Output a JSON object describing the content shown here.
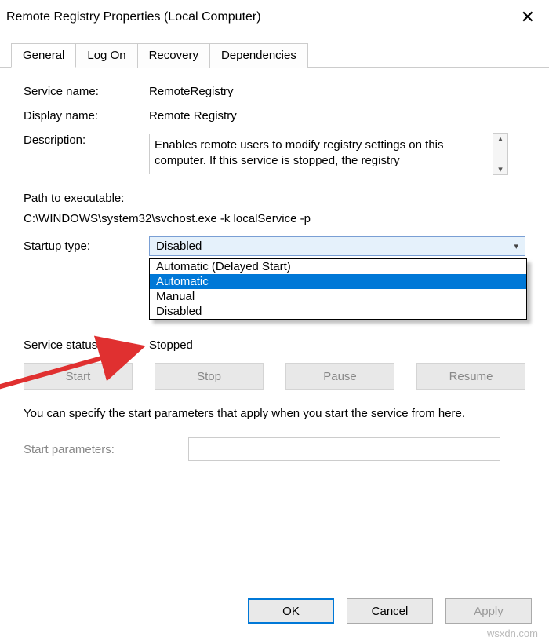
{
  "title": "Remote Registry Properties (Local Computer)",
  "tabs": [
    "General",
    "Log On",
    "Recovery",
    "Dependencies"
  ],
  "labels": {
    "service_name": "Service name:",
    "display_name": "Display name:",
    "description": "Description:",
    "path": "Path to executable:",
    "startup_type": "Startup type:",
    "service_status": "Service status:",
    "start_params": "Start parameters:"
  },
  "values": {
    "service_name": "RemoteRegistry",
    "display_name": "Remote Registry",
    "description": "Enables remote users to modify registry settings on this computer. If this service is stopped, the registry",
    "path": "C:\\WINDOWS\\system32\\svchost.exe -k localService -p",
    "startup_selected": "Disabled",
    "service_status": "Stopped"
  },
  "startup_options": [
    "Automatic (Delayed Start)",
    "Automatic",
    "Manual",
    "Disabled"
  ],
  "svc_buttons": {
    "start": "Start",
    "stop": "Stop",
    "pause": "Pause",
    "resume": "Resume"
  },
  "hint": "You can specify the start parameters that apply when you start the service from here.",
  "footer": {
    "ok": "OK",
    "cancel": "Cancel",
    "apply": "Apply"
  },
  "watermark": "wsxdn.com"
}
